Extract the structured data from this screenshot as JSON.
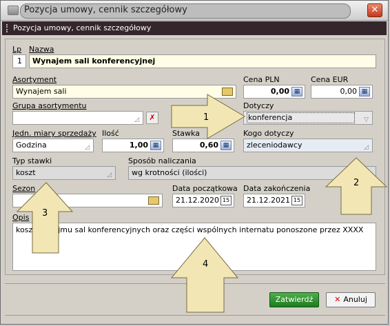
{
  "window": {
    "title": "Pozycja umowy, cennik szczegółowy"
  },
  "panel": {
    "title": "Pozycja umowy, cennik szczegółowy"
  },
  "form": {
    "lp": {
      "label": "Lp",
      "value": "1"
    },
    "nazwa": {
      "label": "Nazwa",
      "value": "Wynajem sali konferencyjnej"
    },
    "asortyment": {
      "label": "Asortyment",
      "value": "Wynajem sali"
    },
    "cena_pln": {
      "label": "Cena PLN",
      "value": "0,00"
    },
    "cena_eur": {
      "label": "Cena EUR",
      "value": "0,00"
    },
    "grupa": {
      "label": "Grupa asortymentu",
      "value": ""
    },
    "dotyczy": {
      "label": "Dotyczy",
      "value": "konferencja"
    },
    "jednostka": {
      "label": "Jedn. miary sprzedaży",
      "value": "Godzina"
    },
    "ilosc": {
      "label": "Ilość",
      "value": "1,00"
    },
    "stawka": {
      "label": "Stawka",
      "value": "0,60"
    },
    "kogo": {
      "label": "Kogo dotyczy",
      "value": "zleceniodawcy"
    },
    "typ_stawki": {
      "label": "Typ stawki",
      "value": "koszt"
    },
    "sposob": {
      "label": "Sposób naliczania",
      "value": "wg krotności (ilości)"
    },
    "sezon": {
      "label": "Sezon",
      "value": ""
    },
    "data_pocz": {
      "label": "Data początkowa",
      "value": "21.12.2020"
    },
    "data_konc": {
      "label": "Data zakończenia",
      "value": "21.12.2021"
    },
    "opis": {
      "label": "Opis",
      "value": "koszt wynajmu sal konferencyjnych oraz części wspólnych internatu ponoszone przez XXXX"
    }
  },
  "buttons": {
    "ok": "Zatwierdź",
    "cancel": "Anuluj"
  },
  "annotations": {
    "a1": "1",
    "a2": "2",
    "a3": "3",
    "a4": "4"
  },
  "icons": {
    "close": "close-icon",
    "folder": "folder-icon",
    "calc": "calculator-icon",
    "calendar": "calendar-icon",
    "clear": "clear-icon",
    "dropdown": "chevron-down-icon"
  },
  "colors": {
    "panel_bar": "#35262c",
    "yellow_field": "#fffde6",
    "arrow_fill": "#f2e7b4",
    "ok_button": "#2a8f2a"
  }
}
